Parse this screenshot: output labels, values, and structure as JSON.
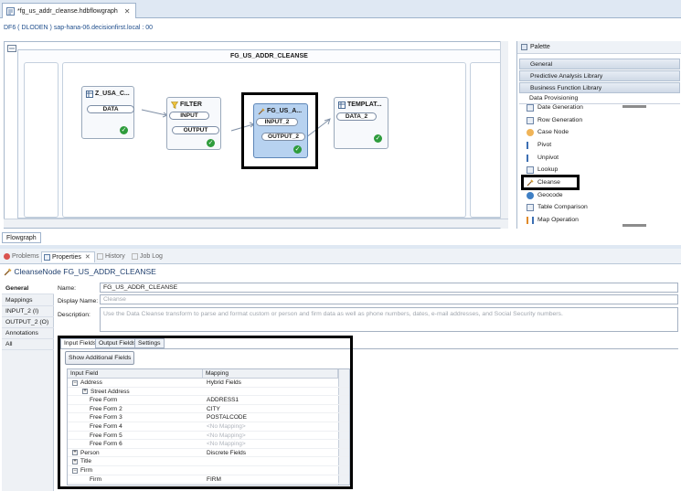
{
  "editor": {
    "tab_label": "*fg_us_addr_cleanse.hdbflowgraph",
    "close_glyph": "✕",
    "connection": "DF6 ( DLODEN )   sap-hana-06.decisionfirst.local : 00"
  },
  "flowgraph": {
    "container_title": "FG_US_ADDR_CLEANSE",
    "nodes": {
      "source": {
        "title": "Z_USA_C...",
        "port_out": "DATA"
      },
      "filter": {
        "title": "FILTER",
        "port_in": "INPUT",
        "port_out": "OUTPUT"
      },
      "cleanse": {
        "title": "FG_US_A...",
        "port_in": "INPUT_2",
        "port_out": "OUTPUT_2"
      },
      "target": {
        "title": "TEMPLAT...",
        "port_in": "DATA_2"
      }
    },
    "bottom_tab": "Flowgraph"
  },
  "palette": {
    "title": "Palette",
    "drawers": [
      "General",
      "Predictive Analysis Library",
      "Business Function Library",
      "Data Provisioning"
    ],
    "items": [
      "Date Generation",
      "Row Generation",
      "Case Node",
      "Pivot",
      "Unpivot",
      "Lookup",
      "Cleanse",
      "Geocode",
      "Table Comparison",
      "Map Operation"
    ]
  },
  "views": {
    "tabs": [
      "Problems",
      "Properties",
      "History",
      "Job Log"
    ],
    "active": "Properties"
  },
  "properties": {
    "title_prefix": "CleanseNode",
    "title_name": "FG_US_ADDR_CLEANSE",
    "nav": [
      "General",
      "Mappings",
      "INPUT_2 (I)",
      "OUTPUT_2 (O)",
      "Annotations",
      "All"
    ],
    "name_label": "Name:",
    "name_value": "FG_US_ADDR_CLEANSE",
    "display_label": "Display Name:",
    "display_placeholder": "Cleanse",
    "desc_label": "Description:",
    "desc_placeholder": "Use the Data Cleanse transform to parse and format custom or person and firm data as well as phone numbers, dates, e-mail addresses, and Social Security numbers.",
    "subtabs": [
      "Input Fields",
      "Output Fields",
      "Settings"
    ],
    "show_button": "Show Additional Fields",
    "table": {
      "headers": [
        "Input Field",
        "Mapping"
      ],
      "rows": [
        {
          "field": "Address",
          "mapping": "Hybrid Fields",
          "level": 0,
          "exp": "−"
        },
        {
          "field": "Street Address",
          "mapping": "",
          "level": 1,
          "exp": "+"
        },
        {
          "field": "Free Form",
          "mapping": "ADDRESS1",
          "level": 2,
          "exp": ""
        },
        {
          "field": "Free Form 2",
          "mapping": "CITY",
          "level": 2,
          "exp": ""
        },
        {
          "field": "Free Form 3",
          "mapping": "POSTALCODE",
          "level": 2,
          "exp": ""
        },
        {
          "field": "Free Form 4",
          "mapping": "<No Mapping>",
          "level": 2,
          "exp": ""
        },
        {
          "field": "Free Form 5",
          "mapping": "<No Mapping>",
          "level": 2,
          "exp": ""
        },
        {
          "field": "Free Form 6",
          "mapping": "<No Mapping>",
          "level": 2,
          "exp": ""
        },
        {
          "field": "Person",
          "mapping": "Discrete Fields",
          "level": 0,
          "exp": "+"
        },
        {
          "field": "Title",
          "mapping": "",
          "level": 0,
          "exp": "+"
        },
        {
          "field": "Firm",
          "mapping": "",
          "level": 0,
          "exp": "−"
        },
        {
          "field": "Firm",
          "mapping": "FIRM",
          "level": 2,
          "exp": ""
        }
      ]
    }
  }
}
